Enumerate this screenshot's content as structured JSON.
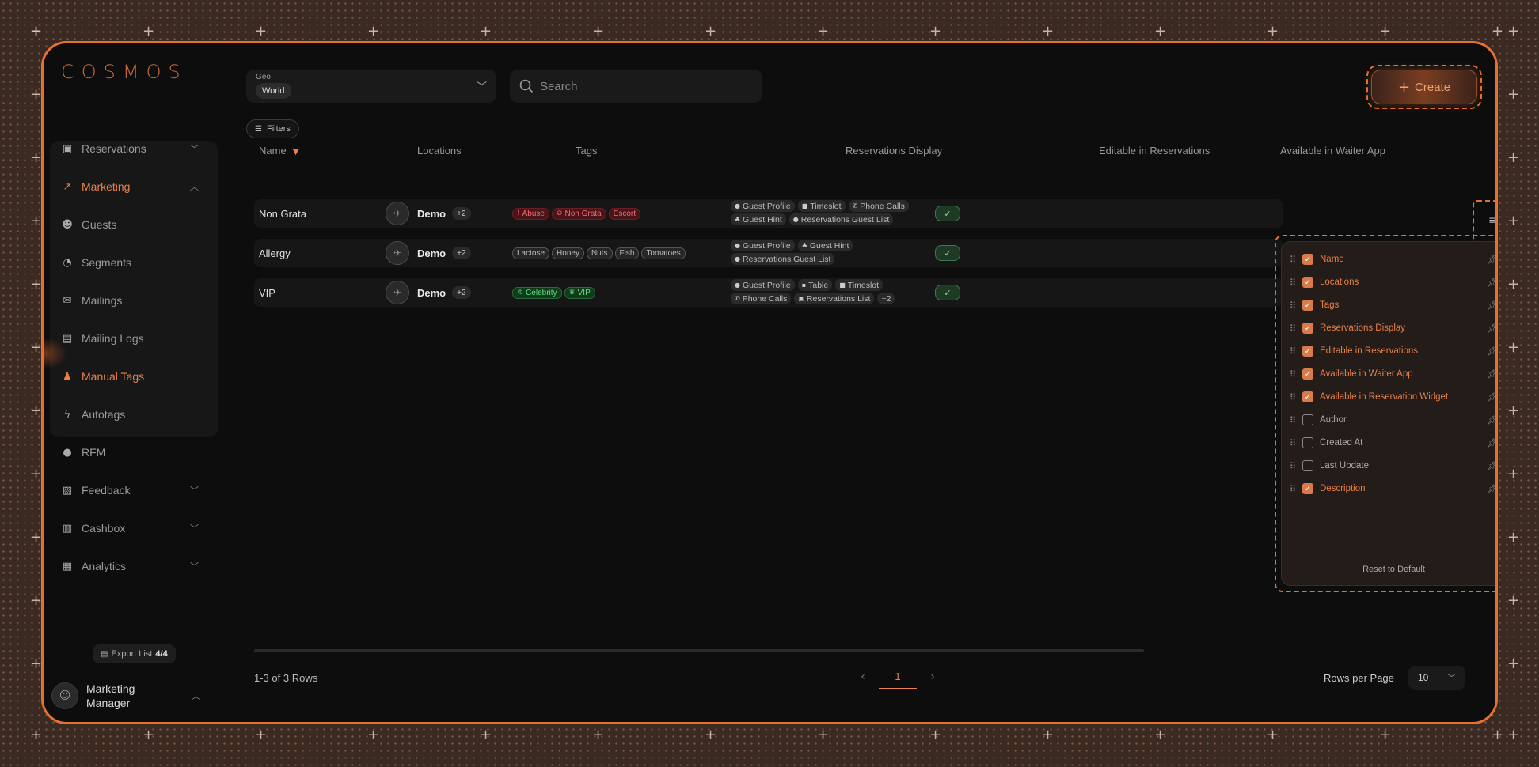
{
  "app": {
    "logo": "COSMOS",
    "accent_color": "#e86f2e"
  },
  "sidebar": {
    "items": [
      {
        "label": "Reservations",
        "icon": "calendar-plus-icon",
        "chevron": "down"
      },
      {
        "label": "Marketing",
        "icon": "trend-icon",
        "chevron": "up"
      },
      {
        "label": "Guests",
        "icon": "smile-icon"
      },
      {
        "label": "Segments",
        "icon": "pie-icon"
      },
      {
        "label": "Mailings",
        "icon": "mail-icon"
      },
      {
        "label": "Mailing Logs",
        "icon": "message-icon"
      },
      {
        "label": "Manual Tags",
        "icon": "users-tag-icon"
      },
      {
        "label": "Autotags",
        "icon": "bolt-icon"
      },
      {
        "label": "RFM",
        "icon": "pin-icon"
      },
      {
        "label": "Feedback",
        "icon": "chat-icon",
        "chevron": "down"
      },
      {
        "label": "Cashbox",
        "icon": "register-icon",
        "chevron": "down"
      },
      {
        "label": "Analytics",
        "icon": "presentation-icon",
        "chevron": "down"
      }
    ],
    "export": {
      "label": "Export List",
      "count": "4/4"
    },
    "user": {
      "line1": "Marketing",
      "line2": "Manager"
    }
  },
  "toolbar": {
    "geo_label": "Geo",
    "geo_value": "World",
    "search_placeholder": "Search",
    "create_label": "Create",
    "filters_label": "Filters"
  },
  "table": {
    "columns": [
      "Name",
      "Locations",
      "Tags",
      "Reservations Display",
      "Editable in Reservations",
      "Available in Waiter App"
    ],
    "rows": [
      {
        "name": "Non Grata",
        "location": "Demo",
        "location_more": "+2",
        "tags": [
          {
            "label": "Abuse",
            "style": "red",
            "icon": "!"
          },
          {
            "label": "Non Grata",
            "style": "red",
            "icon": "⊘"
          },
          {
            "label": "Escort",
            "style": "red",
            "icon": ""
          }
        ],
        "display": [
          {
            "label": "Guest Profile",
            "icon": "●"
          },
          {
            "label": "Timeslot",
            "icon": "■"
          },
          {
            "label": "Phone Calls",
            "icon": "✆"
          },
          {
            "label": "Guest Hint",
            "icon": "♣"
          },
          {
            "label": "Reservations Guest List",
            "icon": "●"
          }
        ]
      },
      {
        "name": "Allergy",
        "location": "Demo",
        "location_more": "+2",
        "tags": [
          {
            "label": "Lactose",
            "style": "gray",
            "icon": ""
          },
          {
            "label": "Honey",
            "style": "gray",
            "icon": ""
          },
          {
            "label": "Nuts",
            "style": "gray",
            "icon": ""
          },
          {
            "label": "Fish",
            "style": "gray",
            "icon": ""
          },
          {
            "label": "Tomatoes",
            "style": "gray",
            "icon": ""
          }
        ],
        "display": [
          {
            "label": "Guest Profile",
            "icon": "●"
          },
          {
            "label": "Guest Hint",
            "icon": "♣"
          },
          {
            "label": "Reservations Guest List",
            "icon": "●"
          }
        ]
      },
      {
        "name": "VIP",
        "location": "Demo",
        "location_more": "+2",
        "tags": [
          {
            "label": "Celebrity",
            "style": "green",
            "icon": "♔"
          },
          {
            "label": "VIP",
            "style": "green",
            "icon": "♛"
          }
        ],
        "display": [
          {
            "label": "Guest Profile",
            "icon": "●"
          },
          {
            "label": "Table",
            "icon": "▪"
          },
          {
            "label": "Timeslot",
            "icon": "■"
          },
          {
            "label": "Phone Calls",
            "icon": "✆"
          },
          {
            "label": "Reservations List",
            "icon": "▣"
          },
          {
            "label": "+2",
            "icon": ""
          }
        ]
      }
    ]
  },
  "column_panel": {
    "items": [
      {
        "label": "Name",
        "checked": true
      },
      {
        "label": "Locations",
        "checked": true
      },
      {
        "label": "Tags",
        "checked": true
      },
      {
        "label": "Reservations Display",
        "checked": true
      },
      {
        "label": "Editable in Reservations",
        "checked": true
      },
      {
        "label": "Available in Waiter App",
        "checked": true
      },
      {
        "label": "Available in Reservation Widget",
        "checked": true
      },
      {
        "label": "Author",
        "checked": false
      },
      {
        "label": "Created At",
        "checked": false
      },
      {
        "label": "Last Update",
        "checked": false
      },
      {
        "label": "Description",
        "checked": true
      }
    ],
    "reset_label": "Reset to Default"
  },
  "footer": {
    "rows_count": "1-3 of 3 Rows",
    "page": "1",
    "rows_per_page_label": "Rows per Page",
    "rows_per_page_value": "10"
  }
}
